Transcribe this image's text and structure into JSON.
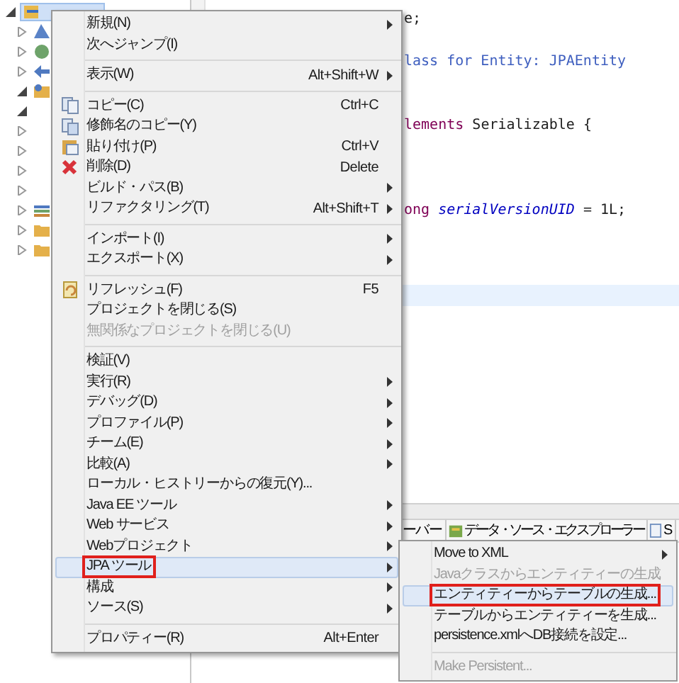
{
  "tree": {
    "items": [
      {
        "expanded": true,
        "selected": true
      },
      {
        "expanded": false,
        "selected": false
      },
      {
        "expanded": false,
        "selected": false
      },
      {
        "expanded": false,
        "selected": false
      },
      {
        "expanded": true,
        "selected": false
      },
      {
        "expanded": true,
        "selected": false
      },
      {
        "expanded": false,
        "selected": false
      },
      {
        "expanded": false,
        "selected": false
      },
      {
        "expanded": false,
        "selected": false
      },
      {
        "expanded": false,
        "selected": false
      },
      {
        "expanded": false,
        "selected": false
      },
      {
        "expanded": false,
        "selected": false
      },
      {
        "expanded": false,
        "selected": false
      }
    ]
  },
  "editor": {
    "lines": [
      {
        "kind": "code",
        "segments": [
          {
            "kind": "plain",
            "text": "e;"
          }
        ]
      },
      {
        "kind": "blank"
      },
      {
        "kind": "code",
        "segments": [
          {
            "kind": "comment",
            "text": "lass for Entity: JPAEntity"
          }
        ]
      },
      {
        "kind": "blank"
      },
      {
        "kind": "blank"
      },
      {
        "kind": "code",
        "segments": [
          {
            "kind": "keyword",
            "text": "lements"
          },
          {
            "kind": "plain",
            "text": " Serializable {"
          }
        ]
      },
      {
        "kind": "blank"
      },
      {
        "kind": "blank"
      },
      {
        "kind": "blank"
      },
      {
        "kind": "code",
        "segments": [
          {
            "kind": "keyword",
            "text": "ong"
          },
          {
            "kind": "field",
            "text": " serialVersionUID"
          },
          {
            "kind": "plain",
            "text": " = 1L;"
          }
        ]
      },
      {
        "kind": "blank"
      },
      {
        "kind": "blank"
      },
      {
        "kind": "blank"
      },
      {
        "kind": "blank",
        "current": true
      }
    ]
  },
  "bottom_panel": {
    "tabs": [
      {
        "label": "ーバー"
      },
      {
        "label": "データ・ソース・エクスプローラー"
      },
      {
        "label": "S"
      }
    ]
  },
  "context_menu": {
    "items": [
      {
        "kind": "item",
        "label": "新規(N)",
        "submenu": true,
        "disabled": false,
        "selected": false
      },
      {
        "kind": "item",
        "label": "次へジャンプ(I)",
        "submenu": false,
        "disabled": false,
        "selected": false
      },
      {
        "kind": "separator"
      },
      {
        "kind": "item",
        "label": "表示(W)",
        "shortcut": "Alt+Shift+W",
        "submenu": true,
        "disabled": false,
        "selected": false
      },
      {
        "kind": "separator"
      },
      {
        "kind": "item",
        "label": "コピー(C)",
        "shortcut": "Ctrl+C",
        "submenu": false,
        "disabled": false,
        "selected": false
      },
      {
        "kind": "item",
        "label": "修飾名のコピー(Y)",
        "submenu": false,
        "disabled": false,
        "selected": false
      },
      {
        "kind": "item",
        "label": "貼り付け(P)",
        "shortcut": "Ctrl+V",
        "submenu": false,
        "disabled": false,
        "selected": false
      },
      {
        "kind": "item",
        "label": "削除(D)",
        "shortcut": "Delete",
        "submenu": false,
        "disabled": false,
        "selected": false
      },
      {
        "kind": "item",
        "label": "ビルド・パス(B)",
        "submenu": true,
        "disabled": false,
        "selected": false
      },
      {
        "kind": "item",
        "label": "リファクタリング(T)",
        "shortcut": "Alt+Shift+T",
        "submenu": true,
        "disabled": false,
        "selected": false
      },
      {
        "kind": "separator"
      },
      {
        "kind": "item",
        "label": "インポート(I)",
        "submenu": true,
        "disabled": false,
        "selected": false
      },
      {
        "kind": "item",
        "label": "エクスポート(X)",
        "submenu": true,
        "disabled": false,
        "selected": false
      },
      {
        "kind": "separator"
      },
      {
        "kind": "item",
        "label": "リフレッシュ(F)",
        "shortcut": "F5",
        "submenu": false,
        "disabled": false,
        "selected": false
      },
      {
        "kind": "item",
        "label": "プロジェクトを閉じる(S)",
        "submenu": false,
        "disabled": false,
        "selected": false
      },
      {
        "kind": "item",
        "label": "無関係なプロジェクトを閉じる(U)",
        "submenu": false,
        "disabled": true,
        "selected": false
      },
      {
        "kind": "separator"
      },
      {
        "kind": "item",
        "label": "検証(V)",
        "submenu": false,
        "disabled": false,
        "selected": false
      },
      {
        "kind": "item",
        "label": "実行(R)",
        "submenu": true,
        "disabled": false,
        "selected": false
      },
      {
        "kind": "item",
        "label": "デバッグ(D)",
        "submenu": true,
        "disabled": false,
        "selected": false
      },
      {
        "kind": "item",
        "label": "プロファイル(P)",
        "submenu": true,
        "disabled": false,
        "selected": false
      },
      {
        "kind": "item",
        "label": "チーム(E)",
        "submenu": true,
        "disabled": false,
        "selected": false
      },
      {
        "kind": "item",
        "label": "比較(A)",
        "submenu": true,
        "disabled": false,
        "selected": false
      },
      {
        "kind": "item",
        "label": "ローカル・ヒストリーからの復元(Y)...",
        "submenu": false,
        "disabled": false,
        "selected": false
      },
      {
        "kind": "item",
        "label": "Java EE ツール",
        "submenu": true,
        "disabled": false,
        "selected": false
      },
      {
        "kind": "item",
        "label": "Web サービス",
        "submenu": true,
        "disabled": false,
        "selected": false
      },
      {
        "kind": "item",
        "label": "Webプロジェクト",
        "submenu": true,
        "disabled": false,
        "selected": false
      },
      {
        "kind": "item",
        "label": "JPA ツール",
        "submenu": true,
        "disabled": false,
        "selected": true,
        "annotated": true
      },
      {
        "kind": "item",
        "label": "構成",
        "submenu": true,
        "disabled": false,
        "selected": false
      },
      {
        "kind": "item",
        "label": "ソース(S)",
        "submenu": true,
        "disabled": false,
        "selected": false
      },
      {
        "kind": "separator"
      },
      {
        "kind": "item",
        "label": "プロパティー(R)",
        "shortcut": "Alt+Enter",
        "submenu": false,
        "disabled": false,
        "selected": false
      }
    ]
  },
  "submenu": {
    "items": [
      {
        "kind": "item",
        "label": "Move to XML",
        "submenu": true,
        "disabled": false,
        "selected": false
      },
      {
        "kind": "item",
        "label": "Javaクラスからエンティティーの生成",
        "submenu": false,
        "disabled": true,
        "selected": false
      },
      {
        "kind": "item",
        "label": "エンティティーからテーブルの生成...",
        "submenu": false,
        "disabled": false,
        "selected": true,
        "annotated": true
      },
      {
        "kind": "item",
        "label": "テーブルからエンティティーを生成...",
        "submenu": false,
        "disabled": false,
        "selected": false
      },
      {
        "kind": "item",
        "label": "persistence.xmlへDB接続を設定...",
        "submenu": false,
        "disabled": false,
        "selected": false
      },
      {
        "kind": "separator"
      },
      {
        "kind": "item",
        "label": "Make Persistent...",
        "submenu": false,
        "disabled": true,
        "selected": false
      }
    ]
  }
}
